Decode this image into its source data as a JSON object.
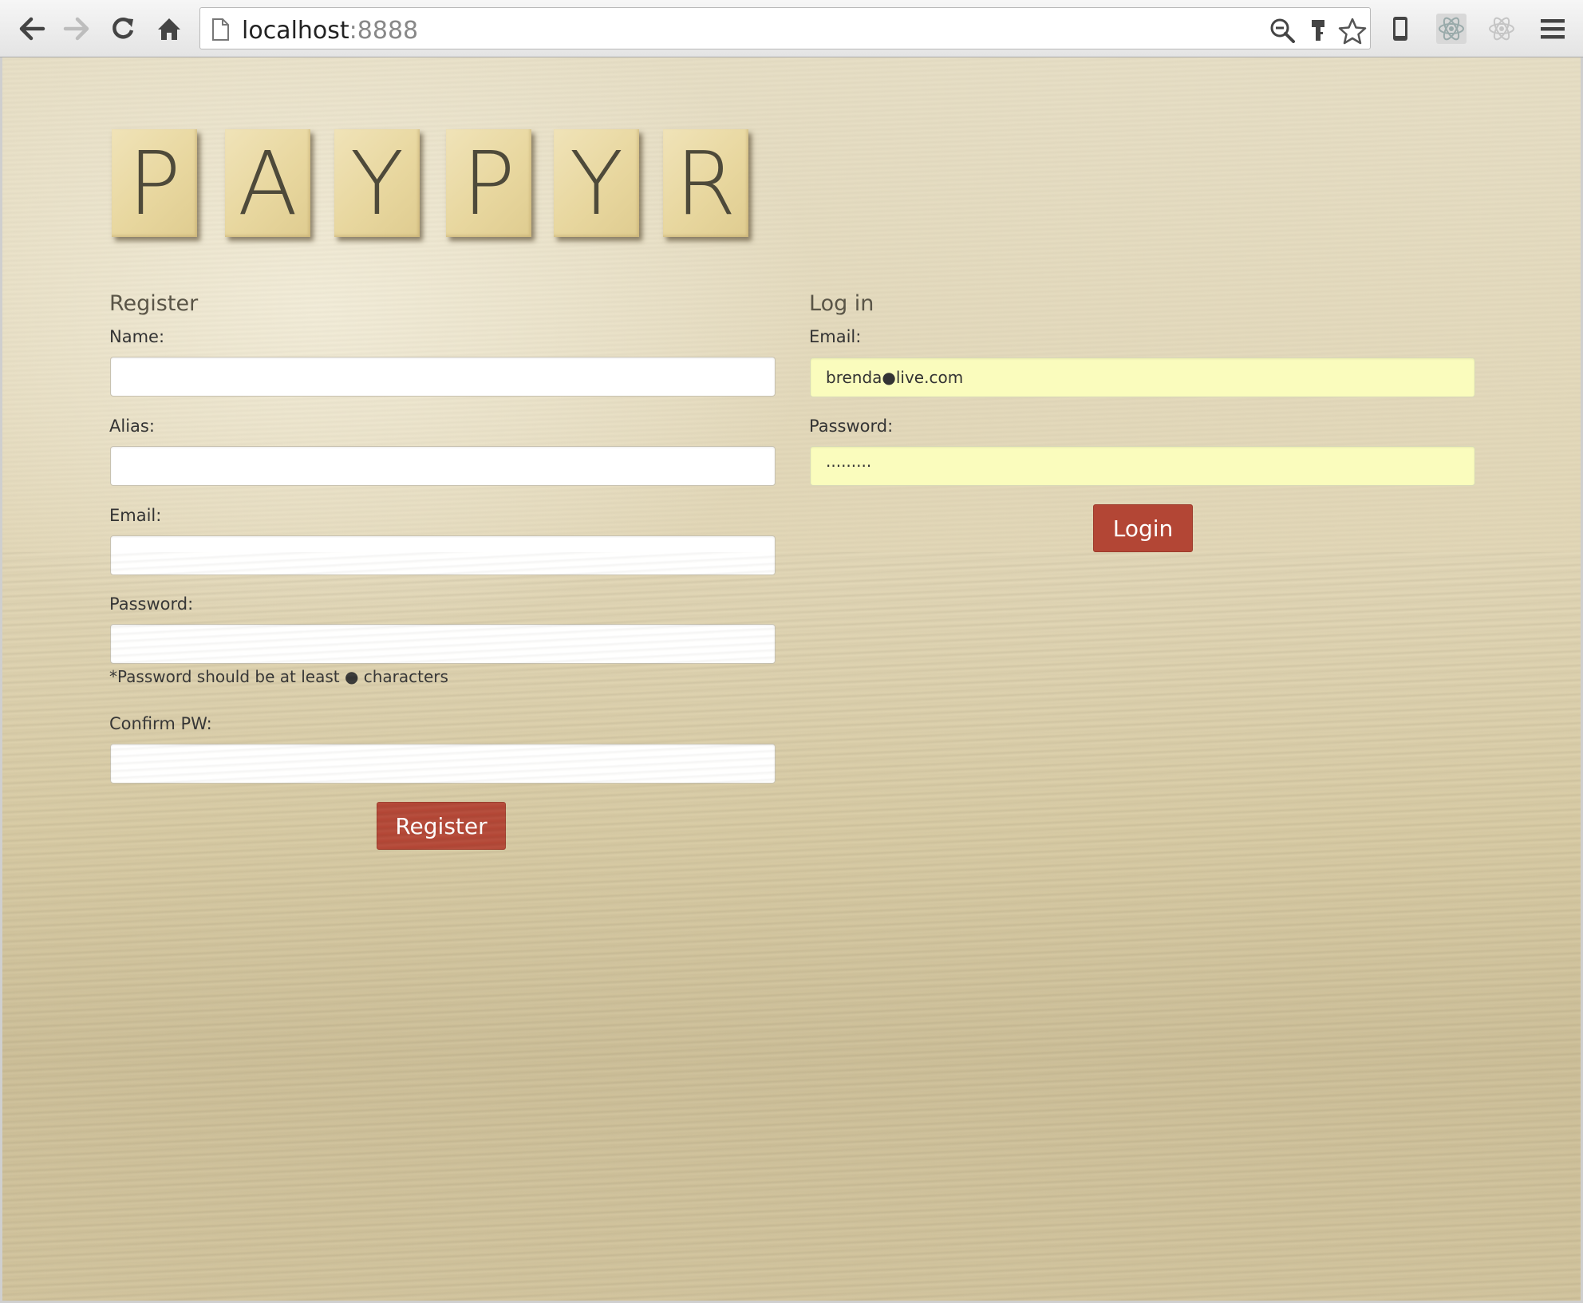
{
  "browser": {
    "url_host": "localhost",
    "url_port": ":8888",
    "icons": [
      "back-icon",
      "forward-icon",
      "reload-icon",
      "home-icon",
      "page-icon",
      "zoom-out-icon",
      "key-icon",
      "star-icon",
      "mobile-device-icon",
      "react-devtools-icon",
      "react-icon-inactive",
      "menu-icon"
    ]
  },
  "logo": {
    "tiles": [
      "P",
      "A",
      "Y",
      "P",
      "Y",
      "R"
    ]
  },
  "register": {
    "title": "Register",
    "name_label": "Name:",
    "name_value": "",
    "alias_label": "Alias:",
    "alias_value": "",
    "email_label": "Email:",
    "email_value": "",
    "password_label": "Password:",
    "password_value": "",
    "password_hint": "*Password should be at least ● characters",
    "confirm_label": "Confirm PW:",
    "confirm_value": "",
    "button_label": "Register"
  },
  "login": {
    "title": "Log in",
    "email_label": "Email:",
    "email_value": "brenda●live.com",
    "password_label": "Password:",
    "password_value": "·········",
    "button_label": "Login"
  },
  "colors": {
    "button": "#b34635",
    "autofill": "#fafcbd",
    "tile": "#e8d79f",
    "tile_letter": "#4e4a3a"
  }
}
